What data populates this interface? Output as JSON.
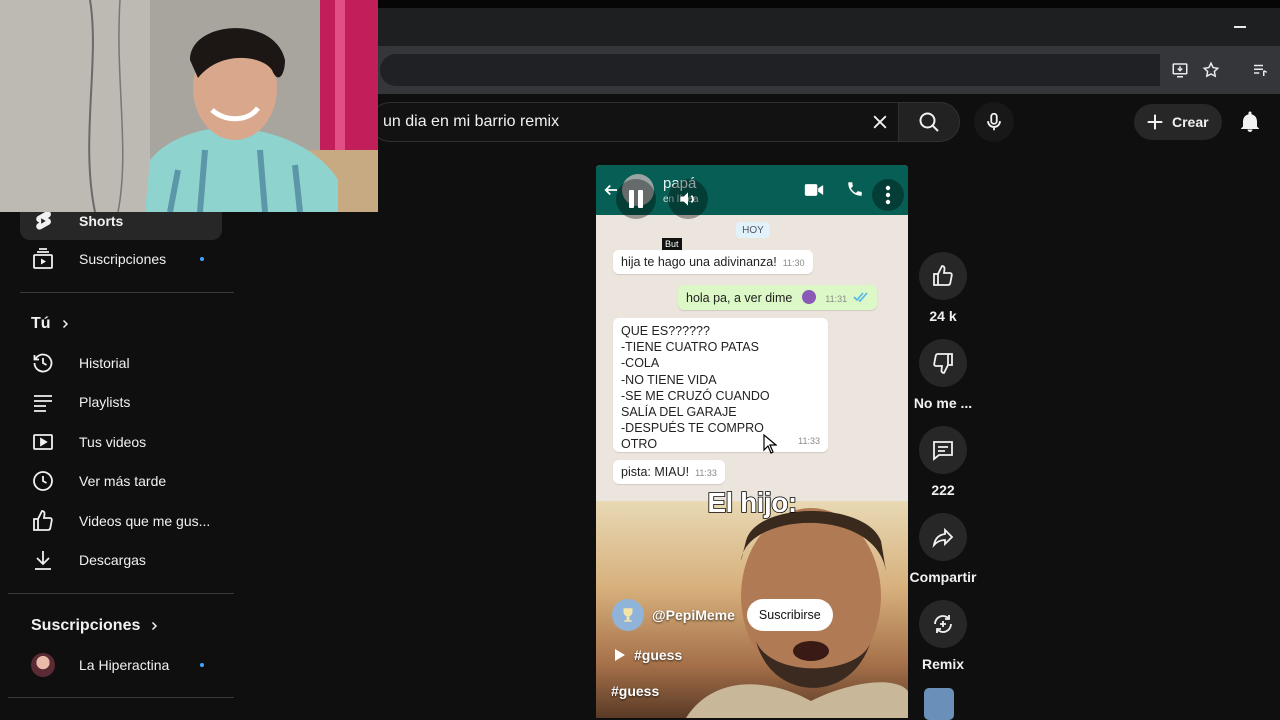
{
  "search": {
    "query": "un dia en mi barrio remix"
  },
  "header": {
    "create_label": "Crear"
  },
  "sidebar": {
    "shorts": "Shorts",
    "subscriptions_item": "Suscripciones",
    "you_section": "Tú",
    "items": [
      {
        "label": "Historial",
        "icon": "history-icon"
      },
      {
        "label": "Playlists",
        "icon": "playlist-icon"
      },
      {
        "label": "Tus videos",
        "icon": "your-videos-icon"
      },
      {
        "label": "Ver más tarde",
        "icon": "watch-later-icon"
      },
      {
        "label": "Videos que me gus...",
        "icon": "thumbs-up-icon"
      },
      {
        "label": "Descargas",
        "icon": "download-icon"
      }
    ],
    "subscriptions_section": "Suscripciones",
    "channels": [
      {
        "label": "La Hiperactina"
      }
    ]
  },
  "short": {
    "chat": {
      "contact_name": "papá",
      "contact_status": "en línea",
      "day": "HOY",
      "tag": "But",
      "messages": [
        {
          "text": "hija te hago una adivinanza!",
          "time": "11:30",
          "dir": "in"
        },
        {
          "text": "hola pa, a ver dime",
          "time": "11:31",
          "dir": "out"
        },
        {
          "text": "QUE ES??????\n-TIENE CUATRO PATAS\n-COLA\n-NO TIENE VIDA\n-SE ME CRUZÓ CUANDO\nSALÍA DEL GARAJE\n-DESPUÉS TE COMPRO\nOTRO",
          "time": "11:33",
          "dir": "in"
        },
        {
          "text": "pista: MIAU!",
          "time": "11:33",
          "dir": "in"
        }
      ]
    },
    "caption": "El hijo:",
    "channel": "@PepiMeme",
    "subscribe_label": "Suscribirse",
    "tag_link": "#guess",
    "title": "#guess"
  },
  "actions": {
    "like_count": "24 k",
    "dislike_label": "No me ...",
    "comment_count": "222",
    "share_label": "Compartir",
    "remix_label": "Remix"
  },
  "colors": {
    "accent": "#3ea6ff",
    "whatsapp_header": "#075e54",
    "background": "#0f0f0f"
  }
}
